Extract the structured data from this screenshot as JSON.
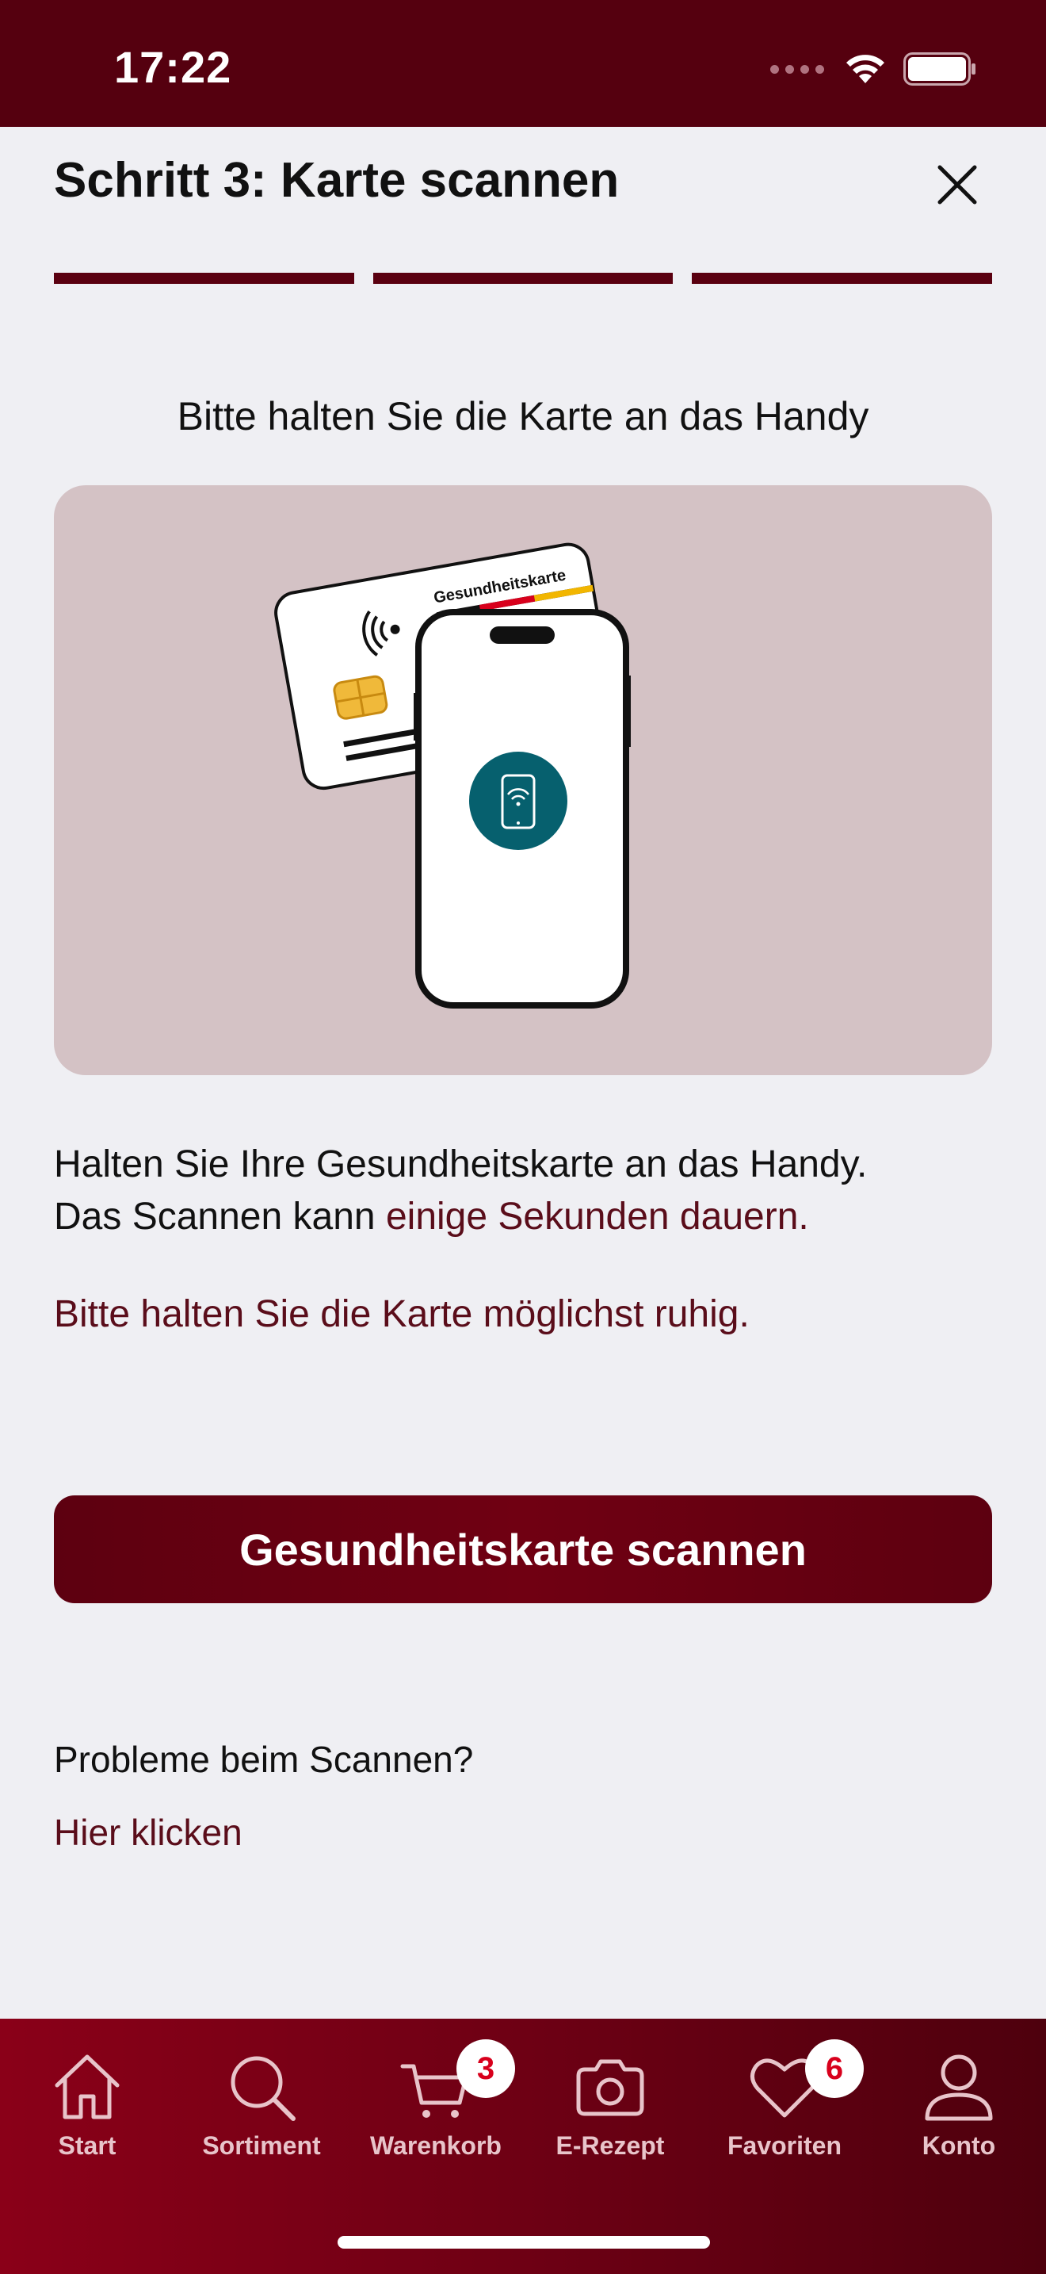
{
  "status_bar": {
    "time": "17:22"
  },
  "header": {
    "title": "Schritt 3: Karte scannen",
    "steps_total": 3,
    "steps_completed": 3
  },
  "instruction": "Bitte halten Sie die Karte an das Handy",
  "illustration": {
    "card_label": "Gesundheitskarte"
  },
  "description": {
    "line1": "Halten Sie Ihre Gesundheitskarte an das Handy.",
    "line2_prefix": "Das Scannen kann ",
    "line2_accent": "einige Sekunden dauern."
  },
  "warning": "Bitte halten Sie die Karte möglichst ruhig.",
  "primary_button": "Gesundheitskarte scannen",
  "help": {
    "label": "Probleme beim Scannen?",
    "link": "Hier klicken"
  },
  "tabbar": {
    "items": [
      {
        "label": "Start",
        "icon": "home-icon"
      },
      {
        "label": "Sortiment",
        "icon": "search-icon"
      },
      {
        "label": "Warenkorb",
        "icon": "cart-icon",
        "badge": "3"
      },
      {
        "label": "E-Rezept",
        "icon": "camera-icon"
      },
      {
        "label": "Favoriten",
        "icon": "heart-icon",
        "badge": "6"
      },
      {
        "label": "Konto",
        "icon": "user-icon"
      }
    ]
  },
  "colors": {
    "brand": "#5a0010",
    "accent_text": "#5a0d1a",
    "illustration_bg": "#d4c2c5",
    "badge_text": "#d8001c"
  }
}
